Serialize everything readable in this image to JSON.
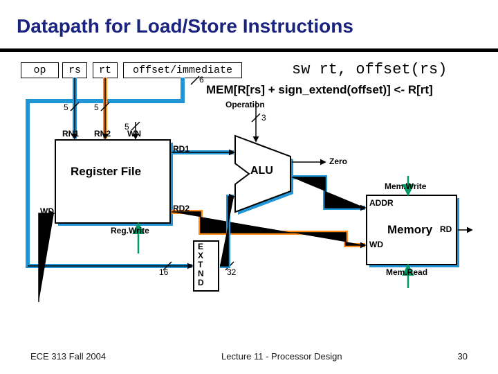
{
  "title": "Datapath for Load/Store Instructions",
  "instruction_fields": {
    "op": "op",
    "rs": "rs",
    "rt": "rt",
    "offset": "offset/immediate"
  },
  "assembly": "sw rt, offset(rs)",
  "rtl": "MEM[R[rs] + sign_extend(offset)] <- R[rt]",
  "bus_widths": {
    "op": "6",
    "rs": "5",
    "rt": "5",
    "wn": "5",
    "operation": "3",
    "extnd_in": "16",
    "extnd_out": "32"
  },
  "labels": {
    "rn1": "RN1",
    "rn2": "RN2",
    "wn": "WN",
    "rd1": "RD1",
    "rd2": "RD2",
    "wd": "WD",
    "regfile": "Register File",
    "regwrite": "Reg.Write",
    "alu": "ALU",
    "operation": "Operation",
    "zero": "Zero",
    "extnd": "EXTND",
    "memory": "Memory",
    "addr": "ADDR",
    "rd": "RD",
    "memwd": "WD",
    "memwrite": "Mem.Write",
    "memread": "Mem.Read"
  },
  "footer": {
    "left": "ECE 313 Fall 2004",
    "center": "Lecture 11 - Processor Design",
    "right": "30"
  },
  "colors": {
    "accent": "#2196d6",
    "highlight": "#ff8c1a",
    "control": "#009966"
  }
}
